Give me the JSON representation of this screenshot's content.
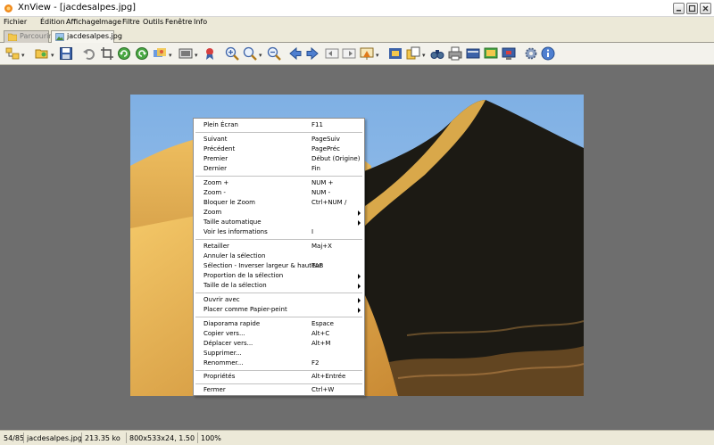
{
  "window": {
    "title": "XnView - [jacdesalpes.jpg]"
  },
  "menubar": [
    "Fichier",
    "Édition",
    "Affichage",
    "Image",
    "Filtre",
    "Outils",
    "Fenêtre",
    "Info"
  ],
  "tabs": [
    {
      "label": "Parcourir",
      "active": false
    },
    {
      "label": "jacdesalpes.jpg",
      "active": true
    }
  ],
  "toolbar": {
    "icons": [
      "browser-icon",
      "open-icon",
      "save-icon",
      "undo-icon",
      "crop-icon",
      "rotate-left-icon",
      "rotate-right-icon",
      "adjust-icon",
      "fit-icon",
      "effects-icon",
      "zoom-in-icon",
      "zoom-icon",
      "zoom-out-icon",
      "previous-icon",
      "next-icon",
      "first-icon",
      "last-icon",
      "slideshow-icon",
      "fullscreen-icon",
      "copy-icon",
      "find-icon",
      "print-icon",
      "scan-icon",
      "capture-icon",
      "wallpaper-icon",
      "settings-icon",
      "info-icon"
    ]
  },
  "context_menu": {
    "groups": [
      [
        {
          "label": "Plein Écran",
          "shortcut": "F11"
        }
      ],
      [
        {
          "label": "Suivant",
          "shortcut": "PageSuiv"
        },
        {
          "label": "Précédent",
          "shortcut": "PagePréc"
        },
        {
          "label": "Premier",
          "shortcut": "Début (Origine)"
        },
        {
          "label": "Dernier",
          "shortcut": "Fin"
        }
      ],
      [
        {
          "label": "Zoom +",
          "shortcut": "NUM +"
        },
        {
          "label": "Zoom -",
          "shortcut": "NUM -"
        },
        {
          "label": "Bloquer le Zoom",
          "shortcut": "Ctrl+NUM /"
        },
        {
          "label": "Zoom",
          "shortcut": "",
          "submenu": true
        },
        {
          "label": "Taille automatique",
          "shortcut": "",
          "submenu": true
        },
        {
          "label": "Voir les informations",
          "shortcut": "I"
        }
      ],
      [
        {
          "label": "Retailler",
          "shortcut": "Maj+X"
        },
        {
          "label": "Annuler la sélection",
          "shortcut": ""
        },
        {
          "label": "Sélection - Inverser largeur & hauteur",
          "shortcut": "TAB"
        },
        {
          "label": "Proportion de la sélection",
          "shortcut": "",
          "submenu": true
        },
        {
          "label": "Taille de la sélection",
          "shortcut": "",
          "submenu": true
        }
      ],
      [
        {
          "label": "Ouvrir avec",
          "shortcut": "",
          "submenu": true
        },
        {
          "label": "Placer comme Papier-peint",
          "shortcut": "",
          "submenu": true
        }
      ],
      [
        {
          "label": "Diaporama rapide",
          "shortcut": "Espace"
        },
        {
          "label": "Copier vers...",
          "shortcut": "Alt+C"
        },
        {
          "label": "Déplacer vers...",
          "shortcut": "Alt+M"
        },
        {
          "label": "Supprimer...",
          "shortcut": ""
        },
        {
          "label": "Renommer...",
          "shortcut": "F2"
        }
      ],
      [
        {
          "label": "Propriétés",
          "shortcut": "Alt+Entrée"
        }
      ],
      [
        {
          "label": "Fermer",
          "shortcut": "Ctrl+W"
        }
      ]
    ]
  },
  "statusbar": {
    "position": "54/85",
    "filename": "jacdesalpes.jpg",
    "filesize": "213.35 ko",
    "dimensions": "800x533x24, 1.50",
    "zoom": "100%"
  },
  "colors": {
    "sky": "#8cb8e8",
    "dune_light": "#e8b850",
    "dune_shadow": "#1c1a14",
    "viewer_bg": "#6e6e6e",
    "chrome": "#ece9d8"
  }
}
